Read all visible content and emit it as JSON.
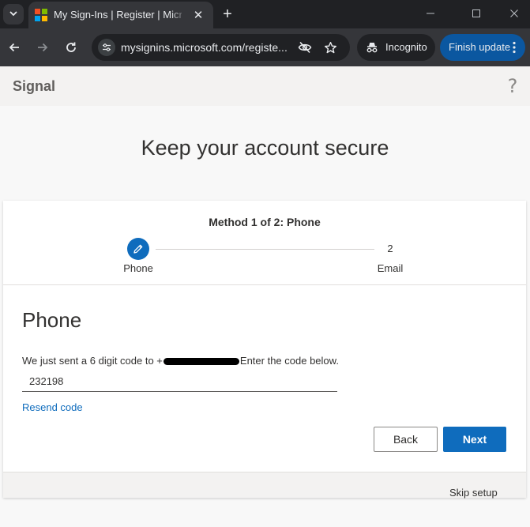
{
  "browser": {
    "tab_title": "My Sign-Ins | Register | Microsoft",
    "tab_close": "✕",
    "new_tab": "+",
    "tab_menu": "⌄",
    "url": "mysignins.microsoft.com/registe...",
    "incognito_label": "Incognito",
    "finish_update_label": "Finish update",
    "favicon_colors": [
      "#f25022",
      "#7fba00",
      "#00a4ef",
      "#ffb900"
    ],
    "icons": {
      "back": "arrow-left-icon",
      "forward": "arrow-right-icon",
      "reload": "reload-icon",
      "site_info": "tune-icon",
      "tracking": "eye-off-icon",
      "bookmark": "star-icon",
      "incognito": "incognito-icon",
      "menu": "kebab-icon"
    }
  },
  "header": {
    "org_name": "Signal",
    "help_glyph": "?"
  },
  "page": {
    "title": "Keep your account secure"
  },
  "stepper": {
    "method_label": "Method 1 of 2: Phone",
    "steps": [
      {
        "label": "Phone",
        "state": "current"
      },
      {
        "number": "2",
        "label": "Email",
        "state": "upcoming"
      }
    ]
  },
  "section": {
    "title": "Phone",
    "instruction_prefix": "We just sent a 6 digit code to +",
    "instruction_suffix": "Enter the code below.",
    "code_value": "232198",
    "resend_label": "Resend code"
  },
  "actions": {
    "back_label": "Back",
    "next_label": "Next"
  },
  "footer": {
    "skip_label": "Skip setup"
  },
  "colors": {
    "accent": "#0f6cbd",
    "finish_update_bg": "#0b57a0",
    "browser_dark": "#202124"
  }
}
